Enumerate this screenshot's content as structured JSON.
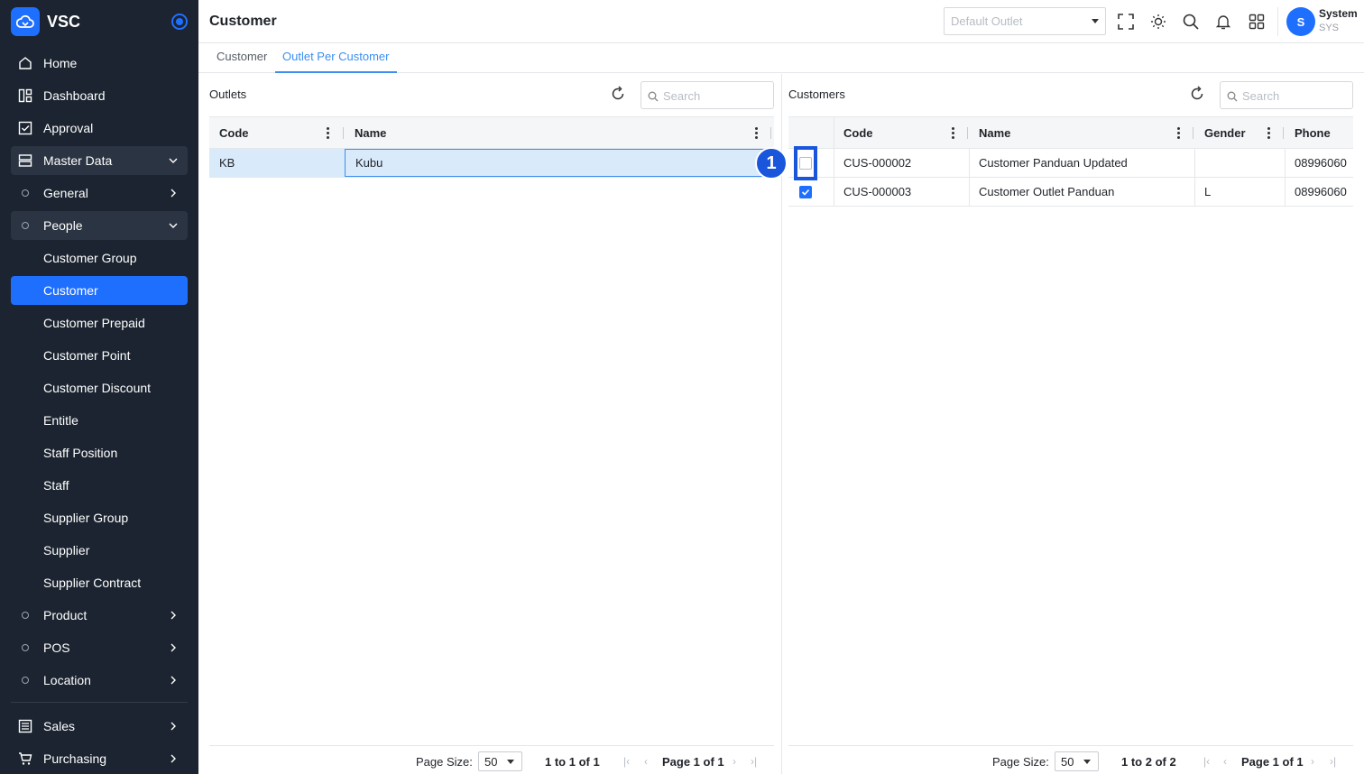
{
  "app": {
    "brand": "VSC",
    "page_title": "Customer"
  },
  "header": {
    "outlet_placeholder": "Default Outlet",
    "user_name": "System",
    "user_code": "SYS",
    "avatar_initial": "S"
  },
  "sidebar": {
    "items": [
      {
        "label": "Home"
      },
      {
        "label": "Dashboard"
      },
      {
        "label": "Approval"
      },
      {
        "label": "Master Data"
      },
      {
        "label": "General"
      },
      {
        "label": "People"
      },
      {
        "label": "Customer Group"
      },
      {
        "label": "Customer"
      },
      {
        "label": "Customer Prepaid"
      },
      {
        "label": "Customer Point"
      },
      {
        "label": "Customer Discount"
      },
      {
        "label": "Entitle"
      },
      {
        "label": "Staff Position"
      },
      {
        "label": "Staff"
      },
      {
        "label": "Supplier Group"
      },
      {
        "label": "Supplier"
      },
      {
        "label": "Supplier Contract"
      },
      {
        "label": "Product"
      },
      {
        "label": "POS"
      },
      {
        "label": "Location"
      },
      {
        "label": "Sales"
      },
      {
        "label": "Purchasing"
      }
    ]
  },
  "tabs": [
    {
      "label": "Customer"
    },
    {
      "label": "Outlet Per Customer"
    }
  ],
  "outlets": {
    "title": "Outlets",
    "search_placeholder": "Search",
    "columns": [
      "Code",
      "Name"
    ],
    "rows": [
      {
        "code": "KB",
        "name": "Kubu"
      }
    ],
    "pager": {
      "page_size_label": "Page Size:",
      "page_size": "50",
      "range": "1 to 1 of 1",
      "page": "Page 1 of 1"
    }
  },
  "customers": {
    "title": "Customers",
    "search_placeholder": "Search",
    "columns": [
      "Code",
      "Name",
      "Gender",
      "Phone"
    ],
    "rows": [
      {
        "checked": false,
        "code": "CUS-000002",
        "name": "Customer Panduan Updated",
        "gender": "",
        "phone": "08996060"
      },
      {
        "checked": true,
        "code": "CUS-000003",
        "name": "Customer Outlet Panduan",
        "gender": "L",
        "phone": "08996060"
      }
    ],
    "pager": {
      "page_size_label": "Page Size:",
      "page_size": "50",
      "range": "1 to 2 of 2",
      "page": "Page 1 of 1"
    }
  },
  "annotation": {
    "marker": "1"
  },
  "colors": {
    "sidebar_bg": "#1b2430",
    "accent": "#1f6fff",
    "tab_active": "#3d8ef0",
    "selected_row": "#d9eafb"
  }
}
